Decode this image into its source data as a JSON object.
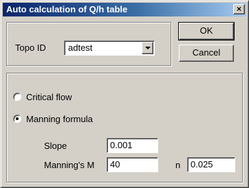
{
  "window": {
    "title": "Auto calculation of Q/h table",
    "close_glyph": "×"
  },
  "topo": {
    "label": "Topo ID",
    "value": "adtest"
  },
  "buttons": {
    "ok": "OK",
    "cancel": "Cancel"
  },
  "method": {
    "options": [
      {
        "label": "Critical flow",
        "checked": false
      },
      {
        "label": "Manning formula",
        "checked": true
      }
    ]
  },
  "manning": {
    "slope_label": "Slope",
    "slope_value": "0.001",
    "m_label": "Manning's M",
    "m_value": "40",
    "n_label": "n",
    "n_value": "0.025"
  },
  "colors": {
    "face": "#d4d0c8",
    "title_start": "#0a246a",
    "title_end": "#a6caf0"
  },
  "icons": {
    "close": "close-icon",
    "combo_arrow": "chevron-down-icon"
  }
}
